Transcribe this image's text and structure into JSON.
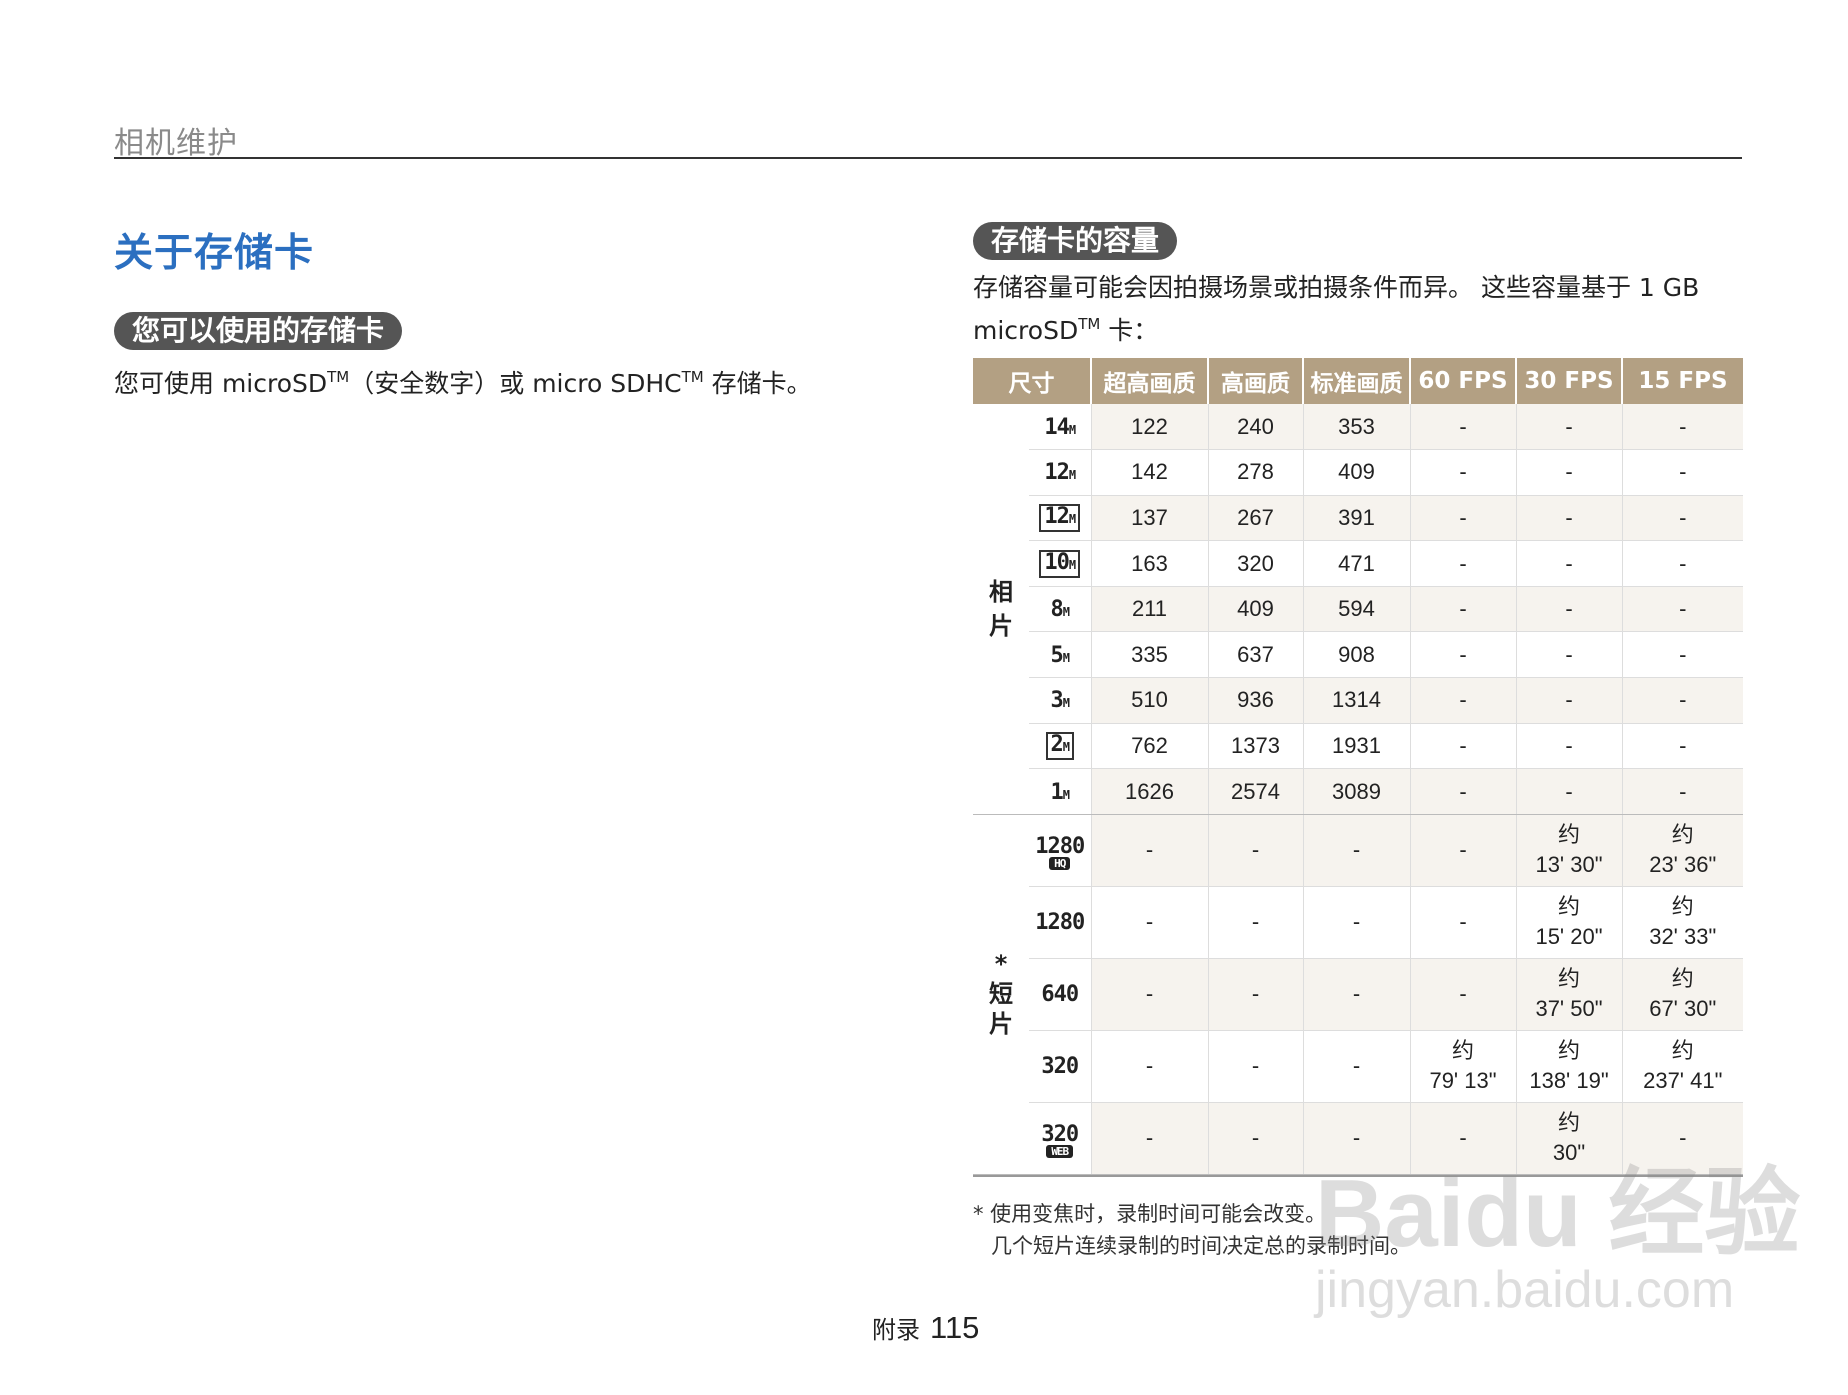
{
  "header": {
    "section": "相机维护"
  },
  "title": "关于存储卡",
  "left": {
    "pill": "您可以使用的存储卡",
    "text_a": "您可使用 microSD",
    "tm1": "TM",
    "text_b": "（安全数字）或 micro SDHC",
    "tm2": "TM",
    "text_c": " 存储卡。"
  },
  "right": {
    "pill": "存储卡的容量",
    "text_a": "存储容量可能会因拍摄场景或拍摄条件而异。 这些容量基于 1 GB microSD",
    "tm": "TM",
    "text_b": " 卡："
  },
  "table": {
    "headers": [
      "尺寸",
      "超高画质",
      "高画质",
      "标准画质",
      "60 FPS",
      "30 FPS",
      "15 FPS"
    ],
    "photo_label": "相\n片",
    "video_label": "*\n短\n片",
    "photo_rows": [
      {
        "icon": "14M",
        "cells": [
          "122",
          "240",
          "353",
          "-",
          "-",
          "-"
        ]
      },
      {
        "icon": "12M",
        "cells": [
          "142",
          "278",
          "409",
          "-",
          "-",
          "-"
        ]
      },
      {
        "icon": "12M",
        "cells": [
          "137",
          "267",
          "391",
          "-",
          "-",
          "-"
        ]
      },
      {
        "icon": "10M",
        "cells": [
          "163",
          "320",
          "471",
          "-",
          "-",
          "-"
        ]
      },
      {
        "icon": "8M",
        "cells": [
          "211",
          "409",
          "594",
          "-",
          "-",
          "-"
        ]
      },
      {
        "icon": "5M",
        "cells": [
          "335",
          "637",
          "908",
          "-",
          "-",
          "-"
        ]
      },
      {
        "icon": "3M",
        "cells": [
          "510",
          "936",
          "1314",
          "-",
          "-",
          "-"
        ]
      },
      {
        "icon": "2M",
        "cells": [
          "762",
          "1373",
          "1931",
          "-",
          "-",
          "-"
        ]
      },
      {
        "icon": "1M",
        "cells": [
          "1626",
          "2574",
          "3089",
          "-",
          "-",
          "-"
        ]
      }
    ],
    "video_rows": [
      {
        "icon": "1280",
        "tag": "HQ",
        "cells": [
          "-",
          "-",
          "-",
          "-",
          "约\n13' 30\"",
          "约\n23' 36\""
        ]
      },
      {
        "icon": "1280",
        "cells": [
          "-",
          "-",
          "-",
          "-",
          "约\n15' 20\"",
          "约\n32' 33\""
        ]
      },
      {
        "icon": "640",
        "cells": [
          "-",
          "-",
          "-",
          "-",
          "约\n37' 50\"",
          "约\n67' 30\""
        ]
      },
      {
        "icon": "320",
        "cells": [
          "-",
          "-",
          "-",
          "约\n79' 13\"",
          "约\n138' 19\"",
          "约\n237' 41\""
        ]
      },
      {
        "icon": "320",
        "tag": "WEB",
        "cells": [
          "-",
          "-",
          "-",
          "-",
          "约\n30\"",
          "-"
        ]
      }
    ]
  },
  "notes": [
    "* 使用变焦时，录制时间可能会改变。",
    "几个短片连续录制的时间决定总的录制时间。"
  ],
  "footer": {
    "label": "附录",
    "page": "115"
  },
  "watermark": {
    "line1": "Baidu 经验",
    "line2": "jingyan.baidu.com"
  }
}
